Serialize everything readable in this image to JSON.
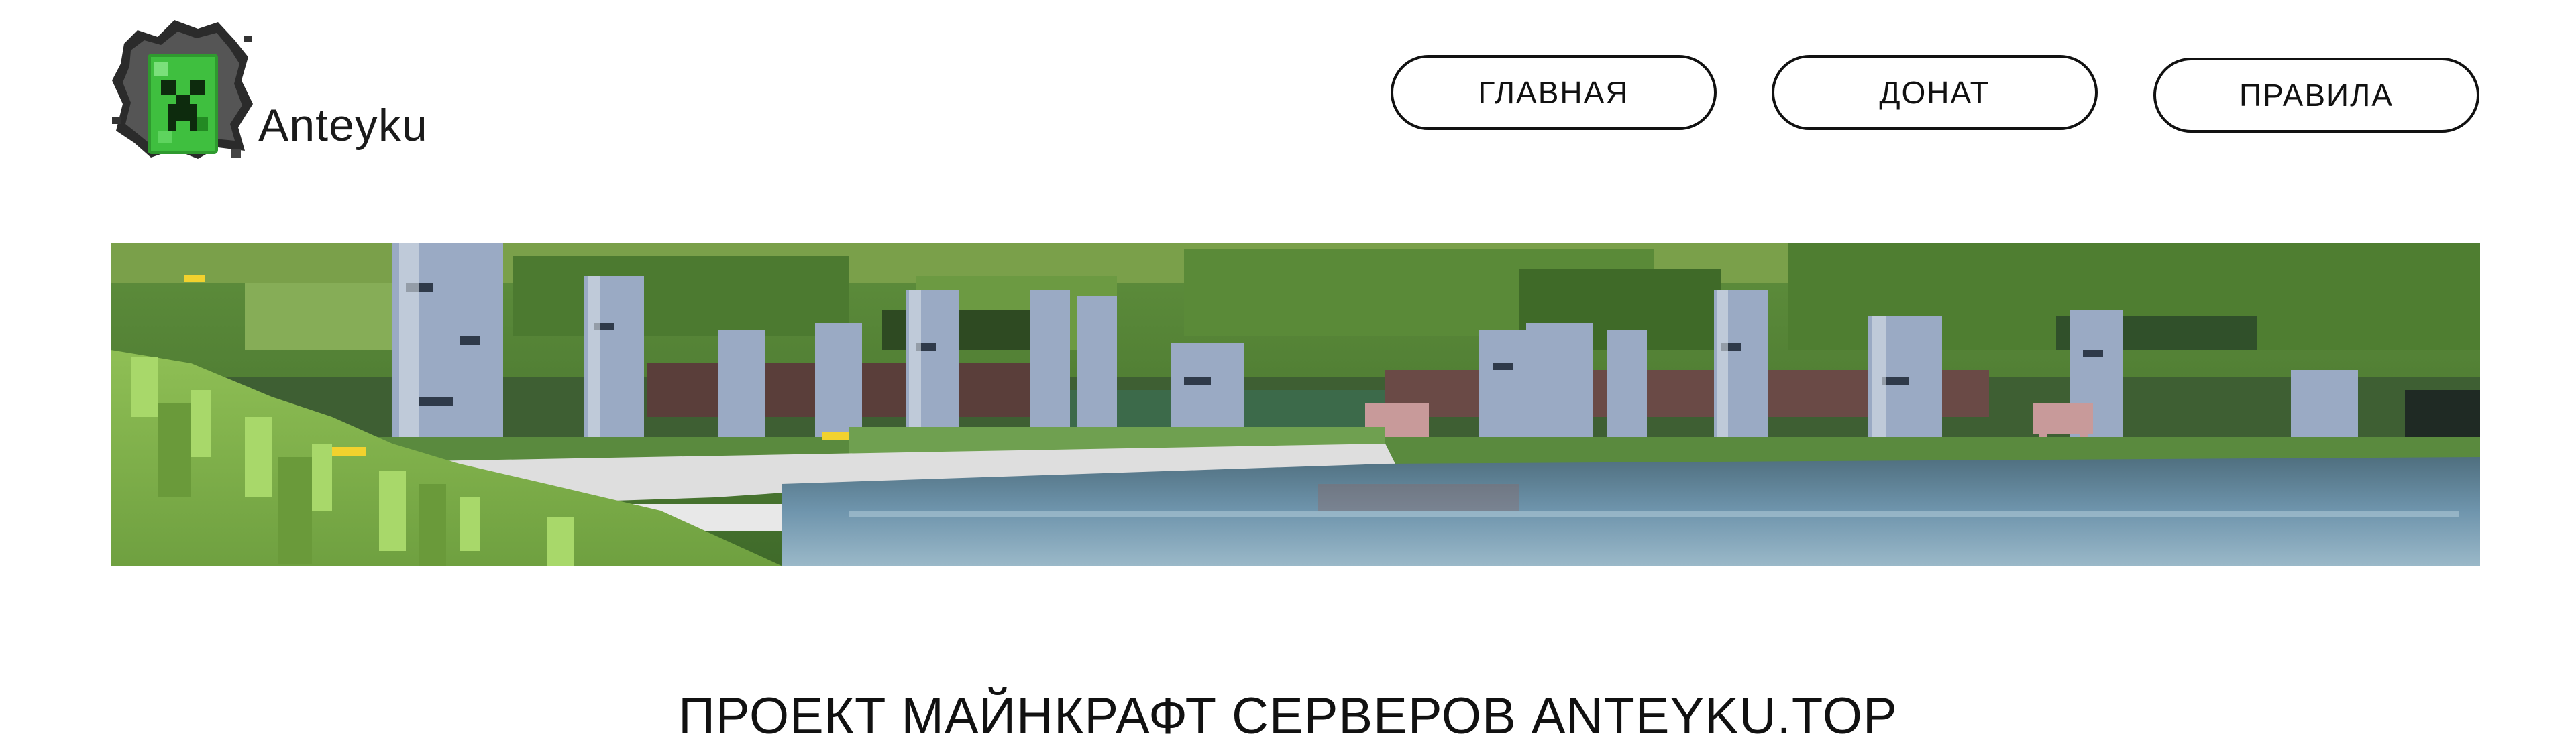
{
  "brand": {
    "name": "Anteyku",
    "logo_icon": "creeper-icon"
  },
  "nav": {
    "items": [
      {
        "label": "ГЛАВНАЯ"
      },
      {
        "label": "ДОНАТ"
      },
      {
        "label": "ПРАВИЛА"
      }
    ]
  },
  "banner": {
    "image": "minecraft-birch-forest-lake-scenery"
  },
  "main": {
    "headline": "ПРОЕКТ МАЙНКРАФТ СЕРВЕРОВ ANTEYKU.TOP"
  },
  "colors": {
    "accent_green": "#3fbf3f",
    "border": "#111111",
    "background": "#ffffff"
  }
}
